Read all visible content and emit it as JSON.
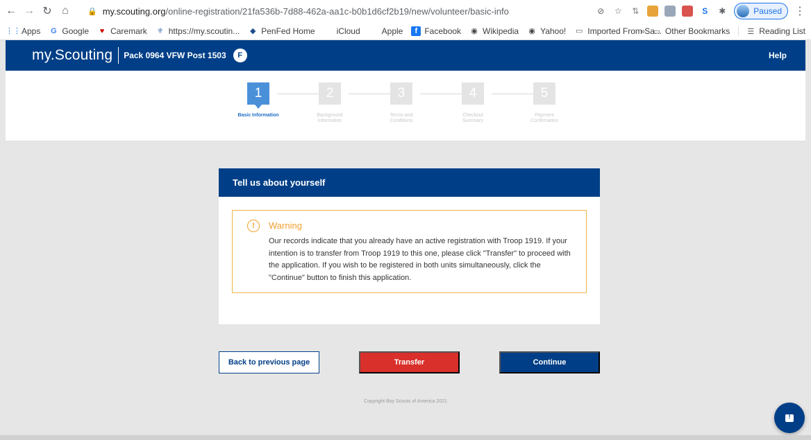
{
  "browser": {
    "url_host": "my.scouting.org",
    "url_path": "/online-registration/21fa536b-7d88-462a-aa1c-b0b1d6cf2b19/new/volunteer/basic-info",
    "profile_status": "Paused",
    "bookmarks": [
      "Apps",
      "Google",
      "Caremark",
      "https://my.scoutin...",
      "PenFed Home",
      "iCloud",
      "Apple",
      "Facebook",
      "Wikipedia",
      "Yahoo!",
      "Imported From Sa..."
    ],
    "overflow": "»",
    "other_bookmarks": "Other Bookmarks",
    "reading_list": "Reading List"
  },
  "header": {
    "brand": "my.Scouting",
    "unit": "Pack 0964 VFW Post 1503",
    "user_initial": "F",
    "help": "Help"
  },
  "stepper": {
    "steps": [
      {
        "number": "1",
        "label": "Basic Information",
        "active": true
      },
      {
        "number": "2",
        "label": "Background Information",
        "active": false
      },
      {
        "number": "3",
        "label": "Terms and Conditions",
        "active": false
      },
      {
        "number": "4",
        "label": "Checkout Summary",
        "active": false
      },
      {
        "number": "5",
        "label": "Payment Confirmation",
        "active": false
      }
    ]
  },
  "card": {
    "title": "Tell us about yourself",
    "warning_title": "Warning",
    "warning_text": "Our records indicate that you already have an active registration with Troop 1919. If your intention is to transfer from Troop 1919 to this one, please click \"Transfer\" to proceed with the application. If you wish to be registered in both units simultaneously, click the \"Continue\" button to finish this application."
  },
  "actions": {
    "back": "Back to previous page",
    "transfer": "Transfer",
    "continue": "Continue"
  },
  "footer": {
    "copyright": "Copyright Boy Scouts of America 2021"
  },
  "colors": {
    "brand_blue": "#003f87",
    "transfer_red": "#d9302b",
    "warning_orange": "#f0a030",
    "active_step": "#4a90d9"
  }
}
